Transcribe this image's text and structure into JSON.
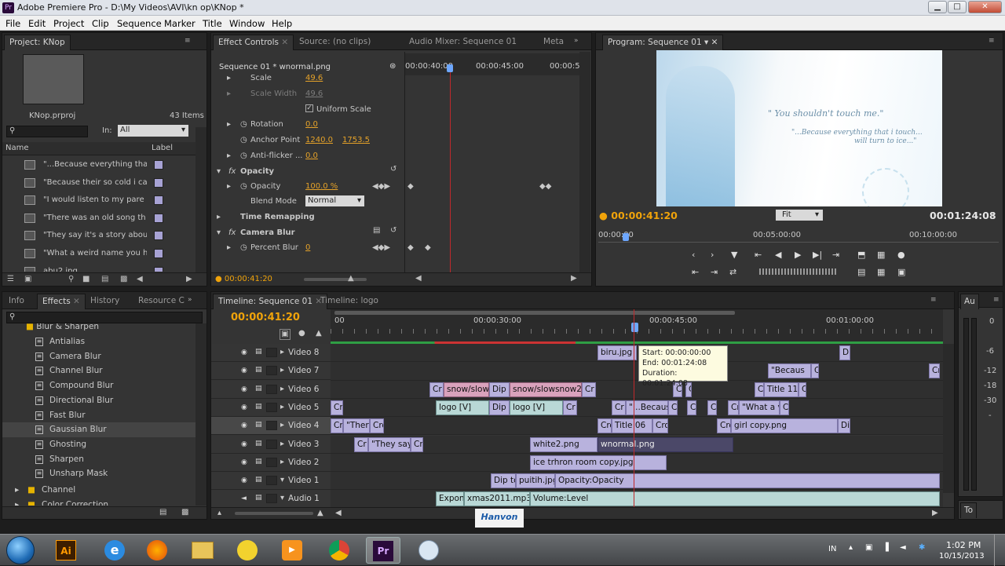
{
  "window": {
    "title": "Adobe Premiere Pro - D:\\My Videos\\AVI\\kn op\\KNop *",
    "app_icon": "Pr"
  },
  "menu": [
    "File",
    "Edit",
    "Project",
    "Clip",
    "Sequence",
    "Marker",
    "Title",
    "Window",
    "Help"
  ],
  "project": {
    "tab": "Project: KNop",
    "filename": "KNop.prproj",
    "items_count": "43 Items",
    "in_label": "In:",
    "in_value": "All",
    "col_name": "Name",
    "col_label": "Label",
    "items": [
      "\"...Because everything that",
      "\"Because their so cold i ca",
      "\"I would listen to my pare",
      "\"There was an old song th",
      "\"They say it's a story abou",
      "\"What a weird name you h",
      "abu2.jpg"
    ]
  },
  "effect_controls": {
    "tabs": [
      "Effect Controls",
      "Source: (no clips)",
      "Audio Mixer: Sequence 01",
      "Meta"
    ],
    "sequence": "Sequence 01 * wnormal.png",
    "timecodes": [
      "00:00:40:00",
      "00:00:45:00",
      "00:00:5"
    ],
    "props": {
      "scale": "Scale",
      "scale_val": "49.6",
      "scale_width": "Scale Width",
      "scale_width_val": "49.6",
      "uniform": "Uniform Scale",
      "rotation": "Rotation",
      "rotation_val": "0.0",
      "anchor": "Anchor Point",
      "anchor_x": "1240.0",
      "anchor_y": "1753.5",
      "antiflicker": "Anti-flicker ...",
      "antiflicker_val": "0.0",
      "opacity_group": "Opacity",
      "opacity": "Opacity",
      "opacity_val": "100.0 %",
      "blend": "Blend Mode",
      "blend_val": "Normal",
      "time_remap": "Time Remapping",
      "camera_blur": "Camera Blur",
      "percent_blur": "Percent Blur",
      "percent_blur_val": "0"
    },
    "current_time": "00:00:41:20"
  },
  "program": {
    "tab": "Program: Sequence 01",
    "current_time": "00:00:41:20",
    "duration": "00:01:24:08",
    "fit": "Fit",
    "ruler": [
      "00:00:00",
      "00:05:00:00",
      "00:10:00:00"
    ],
    "quote1": "\" You shouldn't touch me.\"",
    "quote2a": "\"...Because everything that i touch...",
    "quote2b": "will turn to ice...\""
  },
  "effects": {
    "tabs": [
      "Info",
      "Effects",
      "History",
      "Resource C"
    ],
    "folder": "Blur & Sharpen",
    "items": [
      "Antialias",
      "Camera Blur",
      "Channel Blur",
      "Compound Blur",
      "Directional Blur",
      "Fast Blur",
      "Gaussian Blur",
      "Ghosting",
      "Sharpen",
      "Unsharp Mask"
    ],
    "sub_folders": [
      "Channel",
      "Color Correction"
    ]
  },
  "timeline": {
    "tabs": [
      "Timeline: Sequence 01",
      "Timeline: logo"
    ],
    "current_time": "00:00:41:20",
    "ruler": [
      "00",
      "00:00:30:00",
      "00:00:45:00",
      "00:01:00:00"
    ],
    "tracks": [
      "Video 8",
      "Video 7",
      "Video 6",
      "Video 5",
      "Video 4",
      "Video 3",
      "Video 2",
      "Video 1",
      "Audio 1"
    ],
    "tooltip": {
      "start": "Start: 00:00:00:00",
      "end": "End: 00:01:24:08",
      "duration": "Duration: 00:01:24:08"
    },
    "clips": {
      "v8": [
        "biru.jpg",
        "Dip"
      ],
      "v7": [
        "\"Becaus",
        "Cr",
        "Cr"
      ],
      "v6": [
        "Cr",
        "snow/slow",
        "Dip t",
        "snow/slowsnow2.",
        "Cr",
        "Cr",
        "Cr",
        "C",
        "Title 11",
        "C"
      ],
      "v5": [
        "Cr",
        "logo [V]",
        "Dip t",
        "logo [V]",
        "Cr",
        "Cr",
        "\"...Becaus",
        "C",
        "C",
        "C",
        "Cr",
        "\"What a v",
        "C"
      ],
      "v4": [
        "Cro",
        "\"There",
        "Cro",
        "Cro",
        "Title 06",
        "Cro",
        "Cro",
        "girl copy.png",
        "Dip"
      ],
      "v3": [
        "Cr",
        "\"They say",
        "Cr",
        "white2.png",
        "wnormal.png"
      ],
      "v2": [
        "ice trhron room copy.jpg"
      ],
      "v1": [
        "Dip to",
        "puitih.jpg",
        "Opacity:Opacity"
      ],
      "a1": [
        "Expon",
        "xmas2011.mp3",
        "Volume:Level"
      ]
    }
  },
  "audio_meter": {
    "tab": "Au",
    "labels": [
      "0",
      "-6",
      "-12",
      "-18",
      "-30",
      "-"
    ],
    "bottom_tab": "To"
  },
  "watermark": "Hanvon",
  "taskbar": {
    "lang": "IN",
    "time": "1:02 PM",
    "date": "10/15/2013",
    "apps": [
      "start",
      "illustrator",
      "ie",
      "firefox",
      "explorer",
      "app-duck",
      "media",
      "chrome",
      "premiere",
      "paint"
    ]
  },
  "colors": {
    "accent": "#f0a30a",
    "clip": "#b8b2dd",
    "clip_pink": "#d9a2bc",
    "clip_blue": "#b9d8d6",
    "playhead": "#c0282b"
  }
}
